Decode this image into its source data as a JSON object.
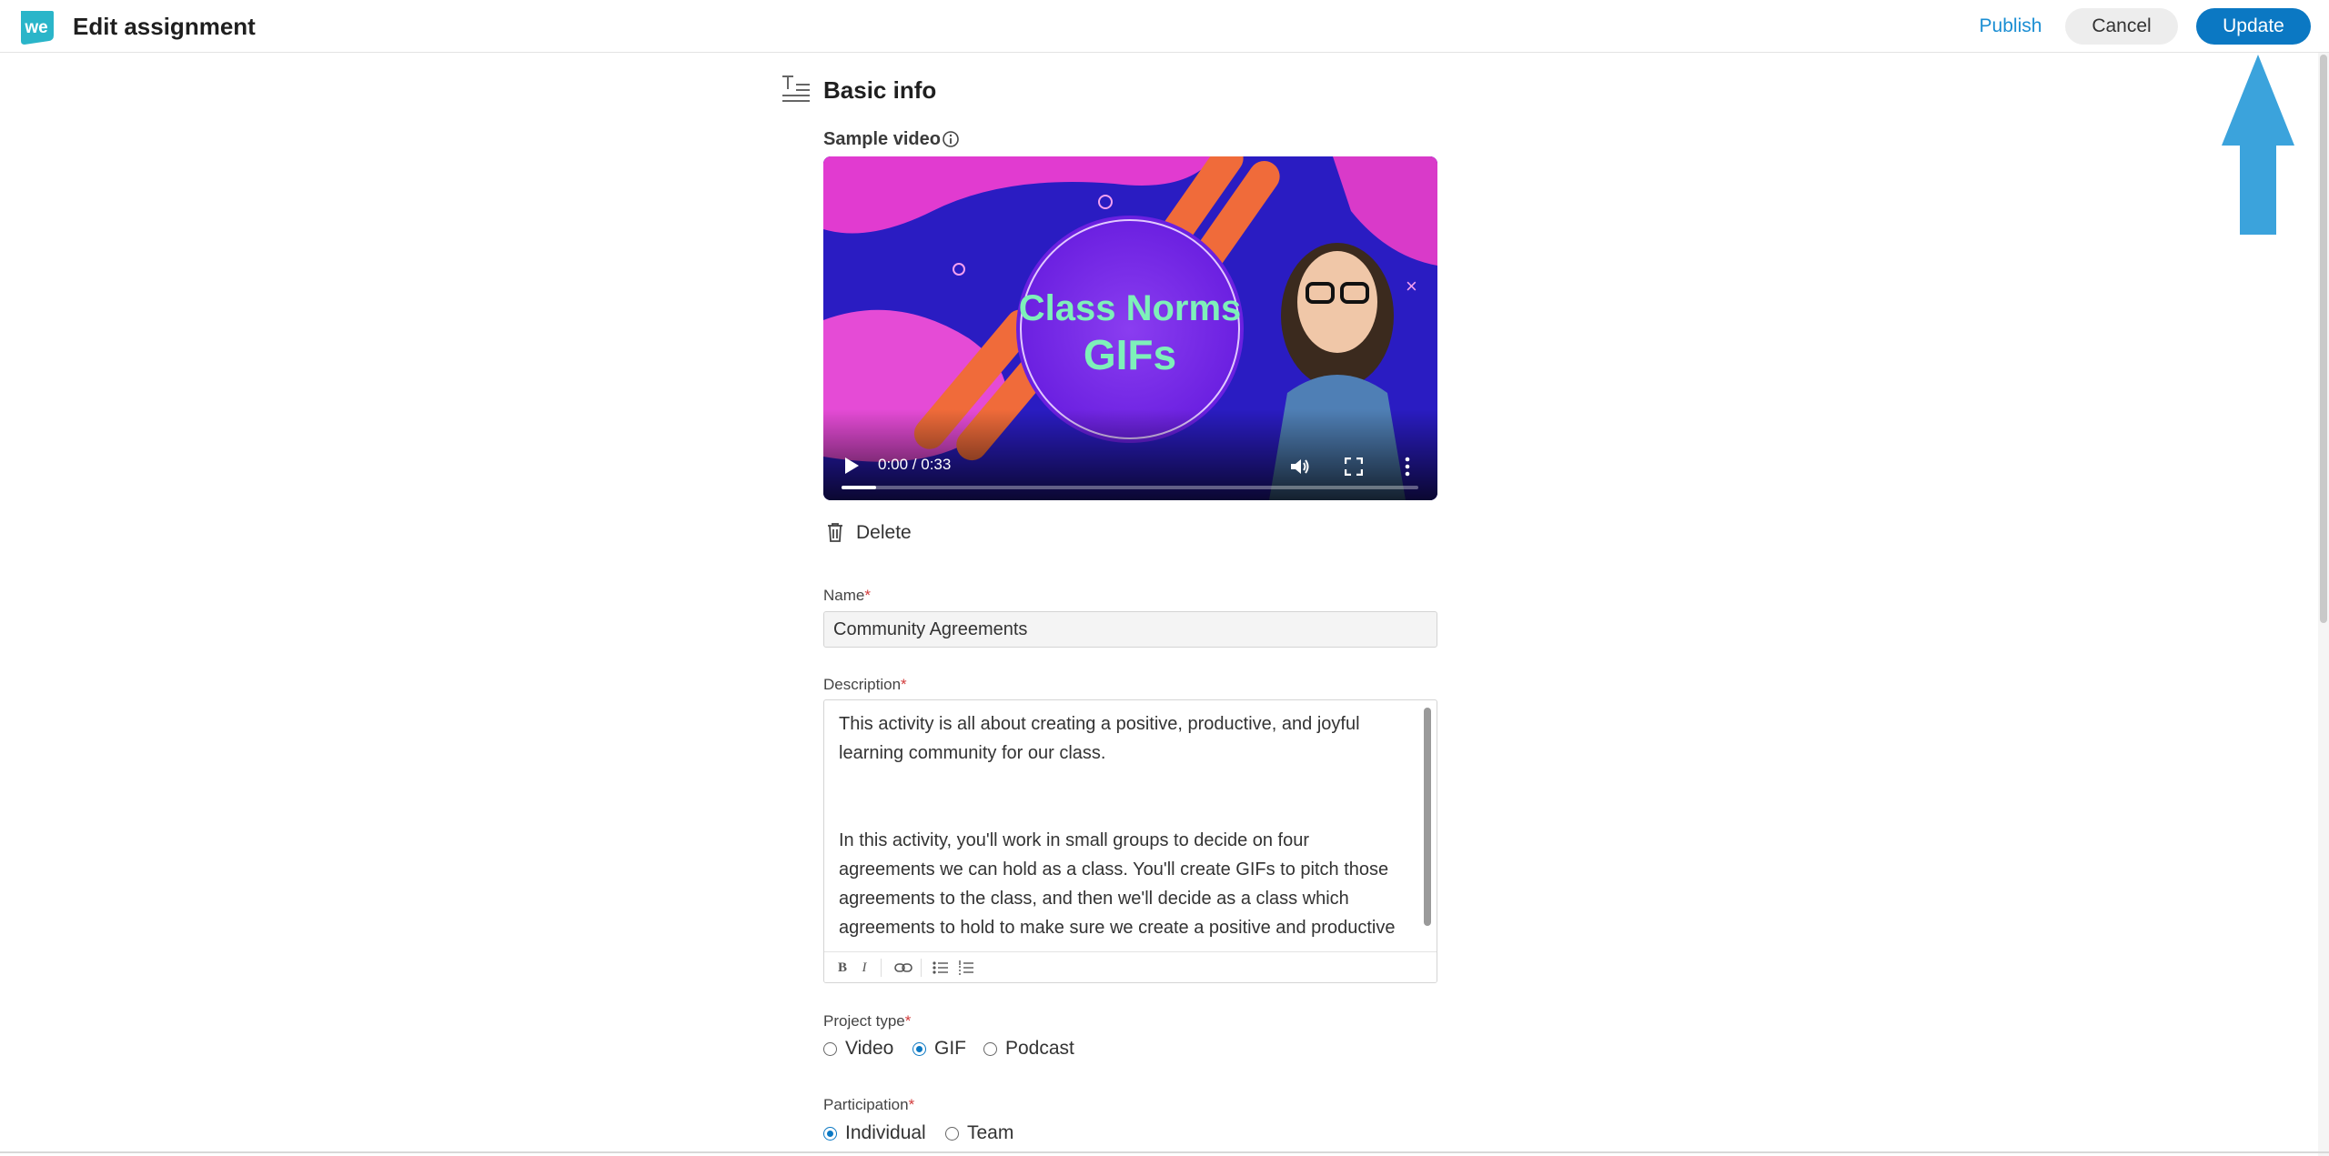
{
  "header": {
    "title": "Edit assignment",
    "publish_label": "Publish",
    "cancel_label": "Cancel",
    "update_label": "Update"
  },
  "section": {
    "title": "Basic info"
  },
  "sample_video": {
    "label": "Sample video",
    "thumbnail_line1": "Class Norms",
    "thumbnail_line2": "GIFs",
    "time": "0:00 / 0:33",
    "progress_fraction": 0.06,
    "delete_label": "Delete"
  },
  "name_field": {
    "label": "Name",
    "required_mark": "*",
    "value": "Community Agreements"
  },
  "description_field": {
    "label": "Description",
    "required_mark": "*",
    "paragraph1_line1": "This activity is all about creating a positive, productive, and joyful",
    "paragraph1_line2": "learning community for our class.",
    "paragraph2_line1": "In this activity, you'll work in small groups to decide on four",
    "paragraph2_line2": "agreements we can hold as a class. You'll create GIFs to pitch those",
    "paragraph2_line3": "agreements to the class, and then we'll decide as a class which",
    "paragraph2_line4": "agreements to hold to make sure we create a positive and productive",
    "toolbar": {
      "bold": "B",
      "italic": "I"
    }
  },
  "project_type": {
    "label": "Project type",
    "required_mark": "*",
    "options": [
      "Video",
      "GIF",
      "Podcast"
    ],
    "selected": "GIF"
  },
  "participation": {
    "label": "Participation",
    "required_mark": "*",
    "options": [
      "Individual",
      "Team"
    ],
    "selected": "Individual"
  },
  "colors": {
    "brand": "#0b78c3",
    "link": "#1a8ed3",
    "arrow": "#3ba3dc",
    "required": "#d23b3b"
  }
}
